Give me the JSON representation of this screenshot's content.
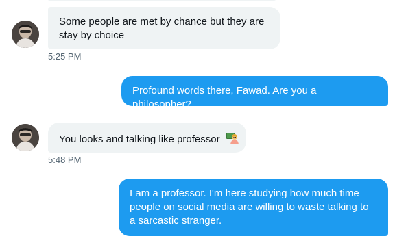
{
  "messages": [
    {
      "direction": "incoming",
      "text": "Some people are met by chance but they are stay by choice",
      "time": "5:25 PM"
    },
    {
      "direction": "outgoing",
      "text": "Profound words there, Fawad. Are you a philosopher?"
    },
    {
      "direction": "incoming",
      "text": "You looks and talking like professor",
      "emoji_icon": "woman-teacher-icon",
      "time": "5:48 PM"
    },
    {
      "direction": "outgoing",
      "text": "I am a professor. I'm here studying how much time people on social media are willing to waste talking to a sarcastic stranger."
    }
  ],
  "colors": {
    "incoming_bubble": "#eff3f4",
    "outgoing_bubble": "#1d9bf0",
    "timestamp": "#536471"
  }
}
